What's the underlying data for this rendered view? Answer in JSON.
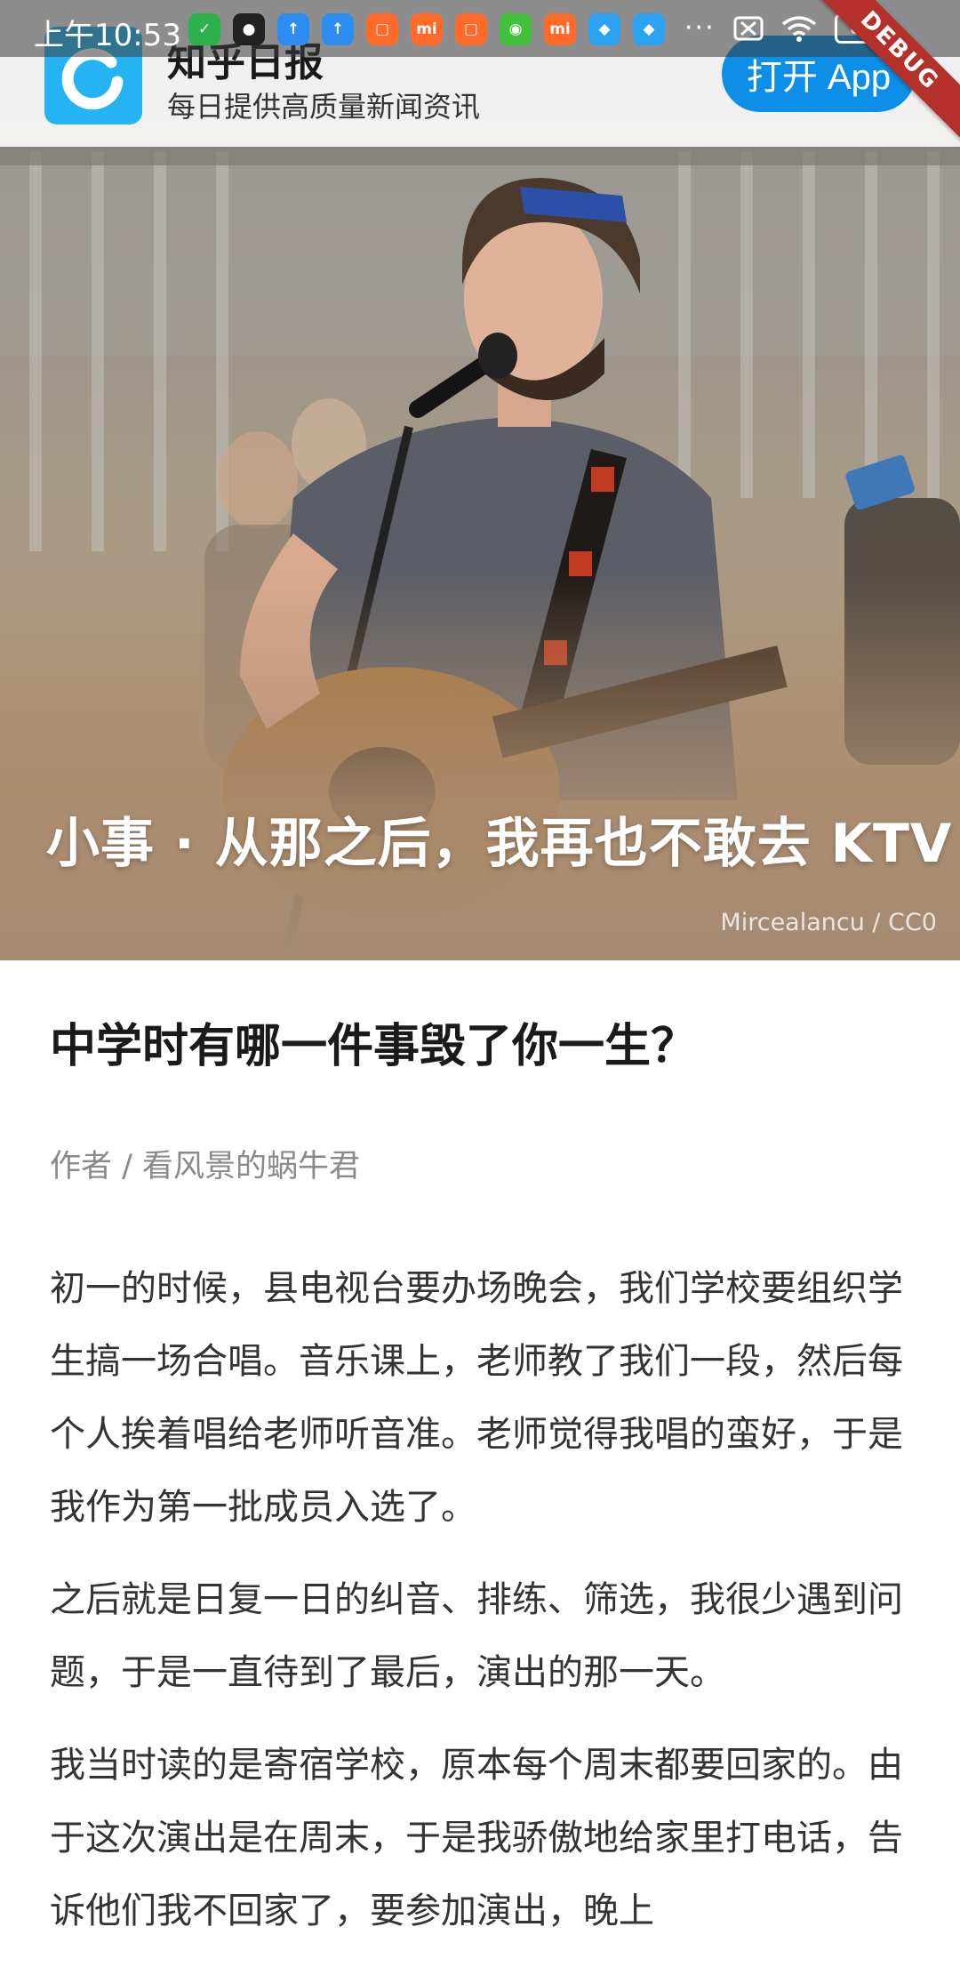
{
  "status_bar": {
    "time": "上午10:53",
    "apps": [
      {
        "icon": "shield-app-icon",
        "glyph": "✓",
        "color": "#2bb24c"
      },
      {
        "icon": "qq-penguin-icon",
        "glyph": "●",
        "color": "#222222"
      },
      {
        "icon": "upload-arrow-icon",
        "glyph": "↑",
        "color": "#2d8cf0"
      },
      {
        "icon": "upload-arrow-icon",
        "glyph": "↑",
        "color": "#2d8cf0"
      },
      {
        "icon": "mi-store-icon",
        "glyph": "▢",
        "color": "#ff6a2a"
      },
      {
        "icon": "mi-icon",
        "glyph": "mi",
        "color": "#ff6a2a"
      },
      {
        "icon": "mi-store-icon",
        "glyph": "▢",
        "color": "#ff6a2a"
      },
      {
        "icon": "android-icon",
        "glyph": "◉",
        "color": "#44c13c"
      },
      {
        "icon": "mi-icon",
        "glyph": "mi",
        "color": "#ff6a2a"
      },
      {
        "icon": "blue-app-icon",
        "glyph": "◆",
        "color": "#2ba3f2"
      },
      {
        "icon": "blue-app-icon",
        "glyph": "◆",
        "color": "#2ba3f2"
      }
    ],
    "more": "···",
    "battery": "82",
    "debug_label": "DEBUG"
  },
  "banner": {
    "app_name": "知乎日报",
    "tagline": "每日提供高质量新闻资讯",
    "open_button": "打开 App",
    "accent": "#0d8fe8"
  },
  "hero": {
    "title": "小事 · 从那之后，我再也不敢去 KTV",
    "credit": "Mircealancu / CC0"
  },
  "article": {
    "question": "中学时有哪一件事毁了你一生？",
    "author": "作者 / 看风景的蜗牛君",
    "paragraphs": [
      "初一的时候，县电视台要办场晚会，我们学校要组织学生搞一场合唱。音乐课上，老师教了我们一段，然后每个人挨着唱给老师听音准。老师觉得我唱的蛮好，于是我作为第一批成员入选了。",
      "之后就是日复一日的纠音、排练、筛选，我很少遇到问题，于是一直待到了最后，演出的那一天。",
      "我当时读的是寄宿学校，原本每个周末都要回家的。由于这次演出是在周末，于是我骄傲地给家里打电话，告诉他们我不回家了，要参加演出，晚上"
    ]
  }
}
